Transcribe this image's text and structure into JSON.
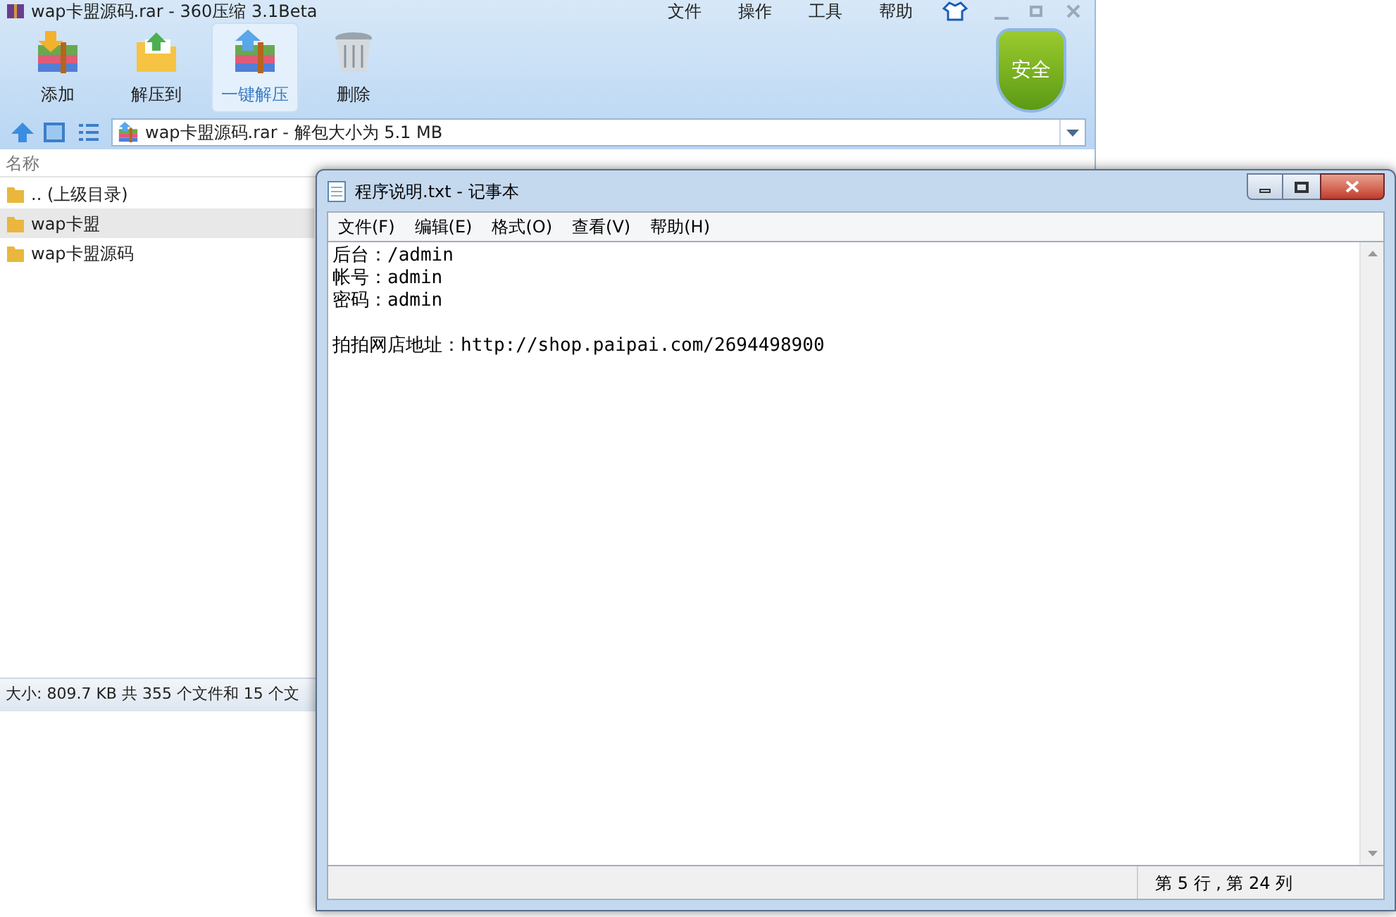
{
  "archive_window": {
    "title": "wap卡盟源码.rar - 360压缩 3.1Beta",
    "menu": [
      "文件",
      "操作",
      "工具",
      "帮助"
    ],
    "toolbar": [
      {
        "label": "添加",
        "kind": "add",
        "selected": false
      },
      {
        "label": "解压到",
        "kind": "extract",
        "selected": false
      },
      {
        "label": "一键解压",
        "kind": "oneclick",
        "selected": true
      },
      {
        "label": "删除",
        "kind": "delete",
        "selected": false
      }
    ],
    "security_badge": "安全",
    "path": "wap卡盟源码.rar - 解包大小为 5.1 MB",
    "column_header": "名称",
    "files": [
      {
        "name": ".. (上级目录)",
        "selected": false
      },
      {
        "name": "wap卡盟",
        "selected": true
      },
      {
        "name": "wap卡盟源码",
        "selected": false
      }
    ],
    "status_bar": "大小: 809.7 KB 共 355 个文件和 15 个文"
  },
  "notepad": {
    "title": "程序说明.txt - 记事本",
    "menu": [
      "文件(F)",
      "编辑(E)",
      "格式(O)",
      "查看(V)",
      "帮助(H)"
    ],
    "paragraphs": [
      [
        "后台：/admin",
        "帐号：admin",
        "密码：admin"
      ],
      [
        "拍拍网店地址：http://shop.paipai.com/2694498900"
      ]
    ],
    "status": "第 5 行 , 第 24 列"
  }
}
